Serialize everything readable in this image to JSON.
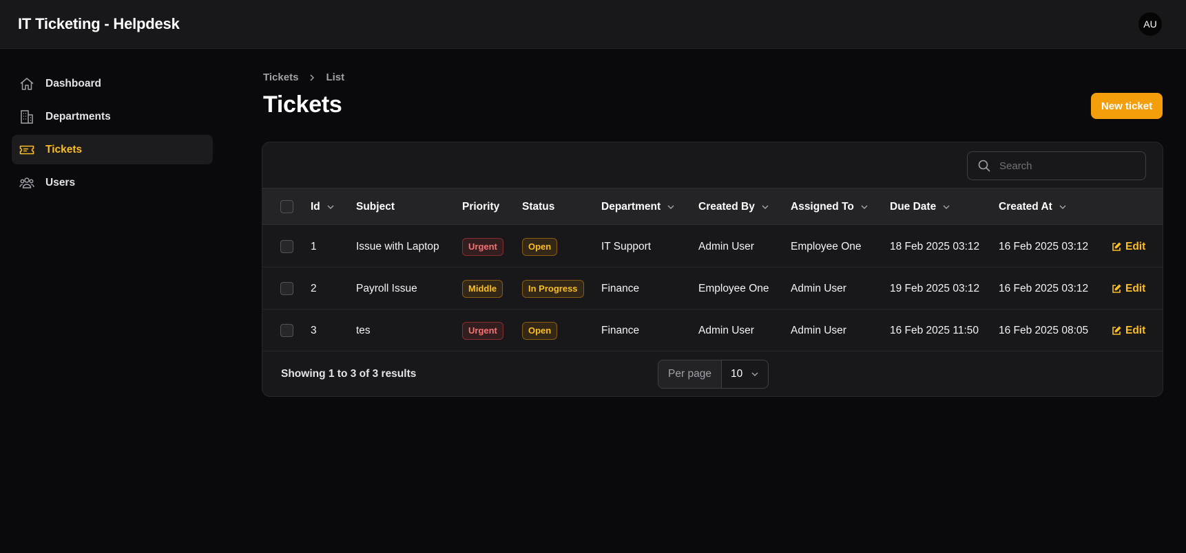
{
  "app": {
    "title": "IT Ticketing - Helpdesk",
    "user_initials": "AU"
  },
  "sidebar": {
    "items": [
      {
        "label": "Dashboard",
        "icon": "home-icon",
        "active": false
      },
      {
        "label": "Departments",
        "icon": "building-icon",
        "active": false
      },
      {
        "label": "Tickets",
        "icon": "ticket-icon",
        "active": true
      },
      {
        "label": "Users",
        "icon": "users-icon",
        "active": false
      }
    ]
  },
  "breadcrumb": {
    "items": [
      "Tickets",
      "List"
    ]
  },
  "page": {
    "title": "Tickets",
    "new_button": "New ticket"
  },
  "search": {
    "placeholder": "Search",
    "value": ""
  },
  "table": {
    "columns": [
      "Id",
      "Subject",
      "Priority",
      "Status",
      "Department",
      "Created By",
      "Assigned To",
      "Due Date",
      "Created At"
    ],
    "rows": [
      {
        "id": "1",
        "subject": "Issue with Laptop",
        "priority": "Urgent",
        "priority_tone": "danger",
        "status": "Open",
        "department": "IT Support",
        "created_by": "Admin User",
        "assigned_to": "Employee One",
        "due_date": "18 Feb 2025 03:12",
        "created_at": "16 Feb 2025 03:12",
        "action": "Edit"
      },
      {
        "id": "2",
        "subject": "Payroll Issue",
        "priority": "Middle",
        "priority_tone": "warning",
        "status": "In Progress",
        "department": "Finance",
        "created_by": "Employee One",
        "assigned_to": "Admin User",
        "due_date": "19 Feb 2025 03:12",
        "created_at": "16 Feb 2025 03:12",
        "action": "Edit"
      },
      {
        "id": "3",
        "subject": "tes",
        "priority": "Urgent",
        "priority_tone": "danger",
        "status": "Open",
        "department": "Finance",
        "created_by": "Admin User",
        "assigned_to": "Admin User",
        "due_date": "16 Feb 2025 11:50",
        "created_at": "16 Feb 2025 08:05",
        "action": "Edit"
      }
    ]
  },
  "pagination": {
    "summary": "Showing 1 to 3 of 3 results",
    "per_page_label": "Per page",
    "per_page_value": "10"
  },
  "colors": {
    "accent": "#f59e0b",
    "danger": "#f87171",
    "background": "#0a0a0c",
    "surface": "#18181b"
  }
}
